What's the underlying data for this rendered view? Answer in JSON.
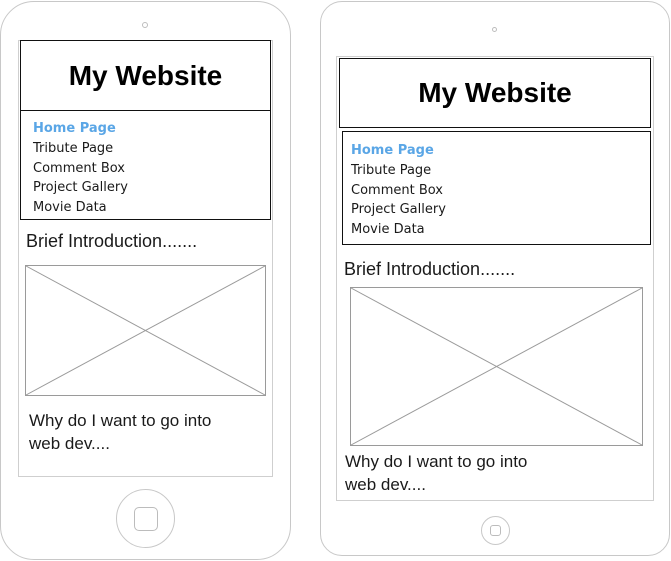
{
  "mockups": [
    {
      "site_title": "My Website",
      "nav_items": [
        "Home Page",
        "Tribute Page",
        "Comment Box",
        "Project Gallery",
        "Movie Data"
      ],
      "active_nav": "Home Page",
      "intro": "Brief Introduction.......",
      "body_line1": "Why do I want to go into",
      "body_line2": "web dev...."
    },
    {
      "site_title": "My Website",
      "nav_items": [
        "Home Page",
        "Tribute Page",
        "Comment Box",
        "Project Gallery",
        "Movie Data"
      ],
      "active_nav": "Home Page",
      "intro": "Brief Introduction.......",
      "body_line1": "Why do I want to go into",
      "body_line2": "web dev...."
    }
  ],
  "icons": {
    "image_placeholder": "image-placeholder-icon"
  },
  "colors": {
    "active_nav": "#5aa6e6",
    "outline": "#111111",
    "device_border": "#c8c8c8"
  }
}
